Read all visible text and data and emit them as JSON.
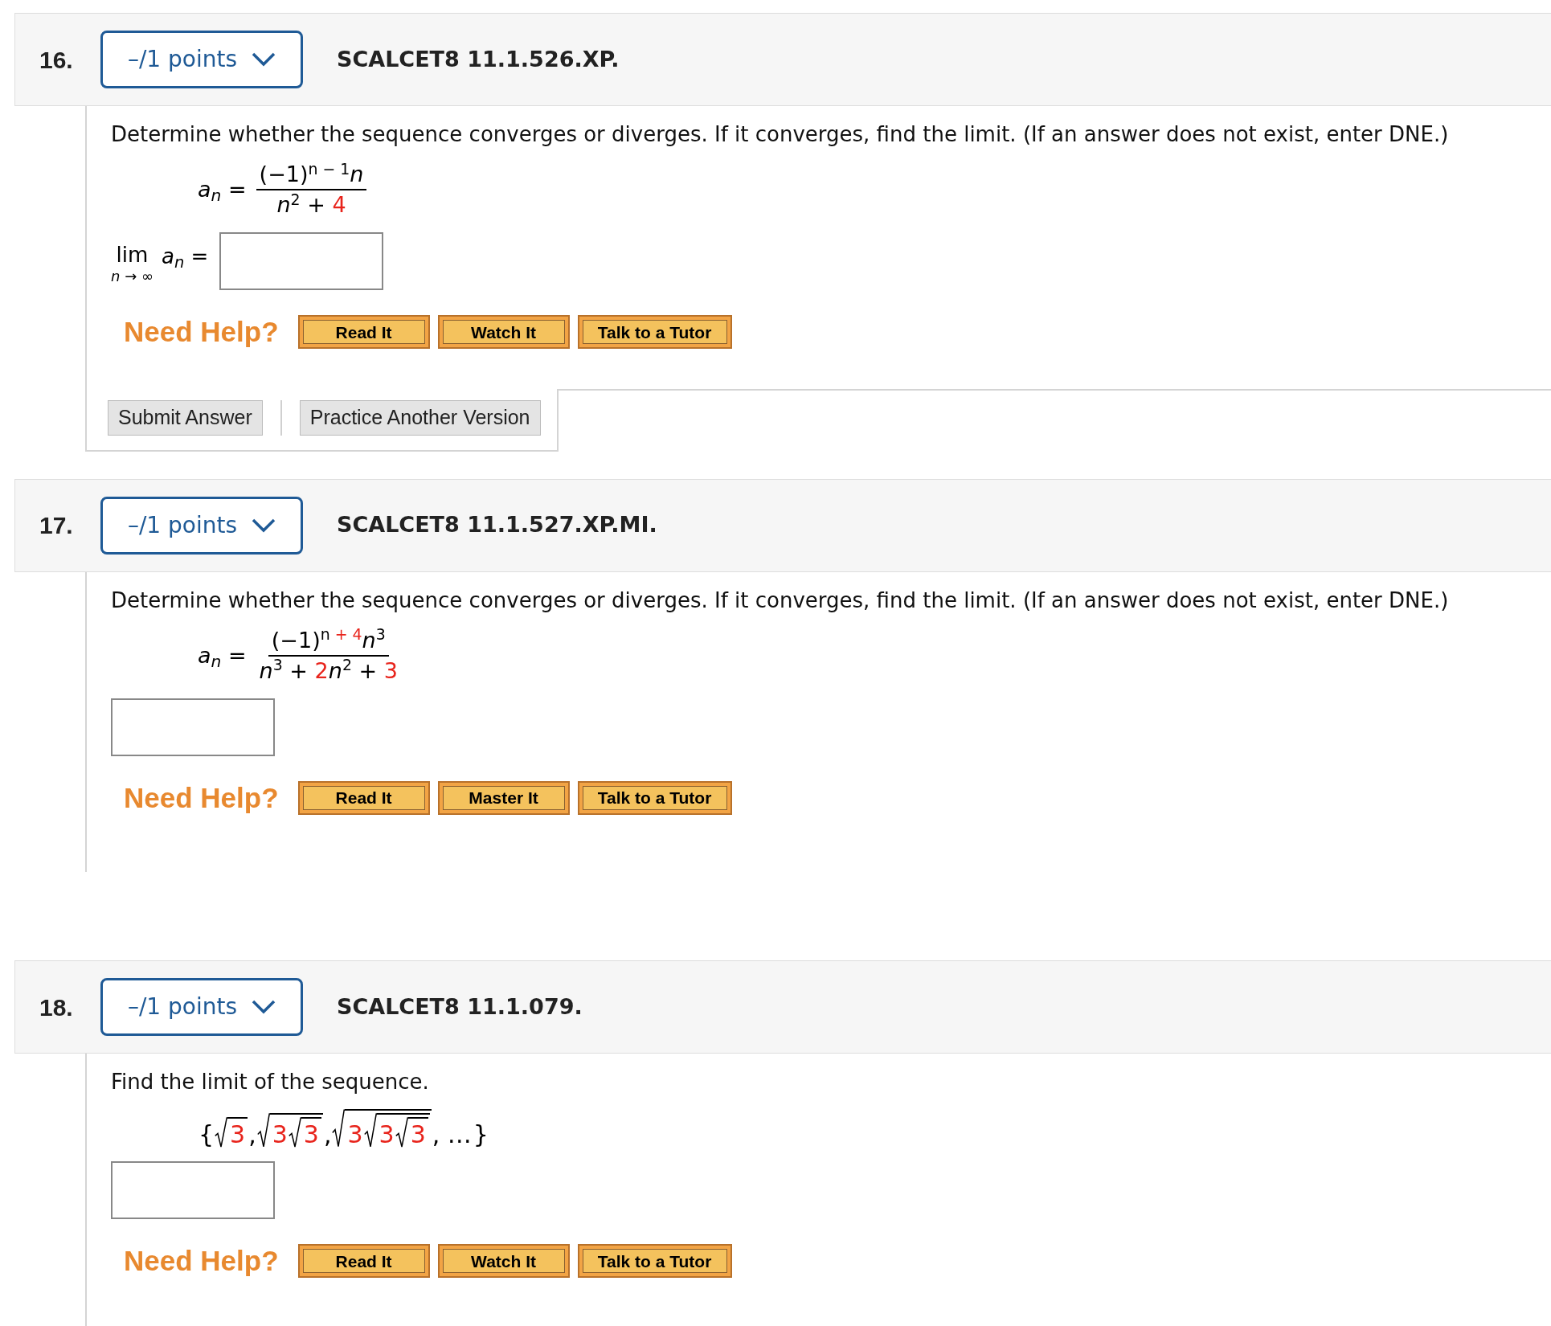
{
  "questions": [
    {
      "number": "16.",
      "points": "–/1 points",
      "title": "SCALCET8 11.1.526.XP.",
      "prompt": "Determine whether the sequence converges or diverges. If it converges, find the limit. (If an answer does not exist, enter DNE.)",
      "formula": {
        "lhs": "*a*$_{n}$ =",
        "numerator": [
          {
            "text": "(−1)$^{n − 1}$*n*",
            "color": "#000000"
          }
        ],
        "denominator": [
          {
            "text": "*n*$^{2}$ + ",
            "color": "#000000"
          },
          {
            "text": "4",
            "color": "#e8241c"
          }
        ]
      },
      "limit": {
        "lim": "lim",
        "under": "*n* → ∞",
        "expr": "*a*$_{n}$ ="
      },
      "help": {
        "label": "Need Help?",
        "buttons": [
          "Read It",
          "Watch It",
          "Talk to a Tutor"
        ]
      },
      "actions": {
        "submit": "Submit Answer",
        "practice": "Practice Another Version"
      }
    },
    {
      "number": "17.",
      "points": "–/1 points",
      "title": "SCALCET8 11.1.527.XP.MI.",
      "prompt": "Determine whether the sequence converges or diverges. If it converges, find the limit. (If an answer does not exist, enter DNE.)",
      "formula": {
        "lhs": "*a*$_{n}$ =",
        "numerator": [
          {
            "text": "(−1)$^{n}$",
            "color": "#000000"
          },
          {
            "text": "$^{ + 4}$",
            "color": "#e8241c"
          },
          {
            "text": "*n*$^{3}$",
            "color": "#000000"
          }
        ],
        "denominator": [
          {
            "text": "*n*$^{3}$ + ",
            "color": "#000000"
          },
          {
            "text": "2",
            "color": "#e8241c"
          },
          {
            "text": "*n*$^{2}$ + ",
            "color": "#000000"
          },
          {
            "text": "3",
            "color": "#e8241c"
          }
        ]
      },
      "help": {
        "label": "Need Help?",
        "buttons": [
          "Read It",
          "Master It",
          "Talk to a Tutor"
        ]
      }
    },
    {
      "number": "18.",
      "points": "–/1 points",
      "title": "SCALCET8 11.1.079.",
      "prompt": "Find the limit of the sequence.",
      "sequence": [
        {
          "kind": "text",
          "text": "{",
          "color": "#000000"
        },
        {
          "kind": "sqrt",
          "children": [
            {
              "kind": "text",
              "text": "3",
              "color": "#e8241c"
            }
          ]
        },
        {
          "kind": "text",
          "text": ",",
          "color": "#000000"
        },
        {
          "kind": "sqrt",
          "children": [
            {
              "kind": "text",
              "text": "3",
              "color": "#e8241c"
            },
            {
              "kind": "sqrt",
              "children": [
                {
                  "kind": "text",
                  "text": "3",
                  "color": "#e8241c"
                }
              ]
            }
          ]
        },
        {
          "kind": "text",
          "text": ",",
          "color": "#000000"
        },
        {
          "kind": "sqrt",
          "children": [
            {
              "kind": "text",
              "text": "3",
              "color": "#e8241c"
            },
            {
              "kind": "sqrt",
              "children": [
                {
                  "kind": "text",
                  "text": "3",
                  "color": "#e8241c"
                },
                {
                  "kind": "sqrt",
                  "children": [
                    {
                      "kind": "text",
                      "text": "3",
                      "color": "#e8241c"
                    }
                  ]
                }
              ]
            }
          ]
        },
        {
          "kind": "text",
          "text": ", …",
          "color": "#000000"
        },
        {
          "kind": "text",
          "text": "}",
          "color": "#000000"
        }
      ],
      "help": {
        "label": "Need Help?",
        "buttons": [
          "Read It",
          "Watch It",
          "Talk to a Tutor"
        ]
      }
    }
  ]
}
